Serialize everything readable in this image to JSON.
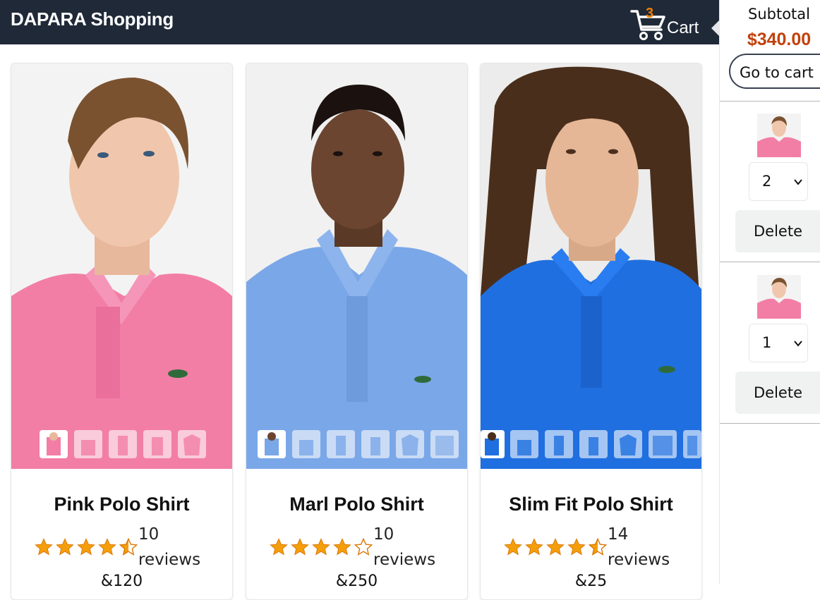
{
  "header": {
    "brand": "DAPARA Shopping",
    "cart_count": "3",
    "cart_label": "Cart",
    "cart_icon": "cart-icon"
  },
  "colors": {
    "header_bg": "#1f2937",
    "price_accent": "#c2410c",
    "cart_badge": "#f08000",
    "star": "#f59e0b"
  },
  "products": [
    {
      "name": "Pink Polo Shirt",
      "rating": 4.5,
      "reviews_count": "10",
      "reviews_word": "reviews",
      "price": "&120",
      "shirt_color": "#f27ea5",
      "thumbnail_count": 5
    },
    {
      "name": "Marl Polo Shirt",
      "rating": 4.0,
      "reviews_count": "10",
      "reviews_word": "reviews",
      "price": "&250",
      "shirt_color": "#7aa7e8",
      "thumbnail_count": 6
    },
    {
      "name": "Slim Fit Polo Shirt",
      "rating": 4.5,
      "reviews_count": "14",
      "reviews_word": "reviews",
      "price": "&25",
      "shirt_color": "#1f6fe0",
      "thumbnail_count": 7
    }
  ],
  "sidebar": {
    "subtotal_label": "Subtotal",
    "subtotal_value": "$340.00",
    "go_to_cart": "Go to cart",
    "items": [
      {
        "qty": "2",
        "delete_label": "Delete"
      },
      {
        "qty": "1",
        "delete_label": "Delete"
      }
    ]
  }
}
